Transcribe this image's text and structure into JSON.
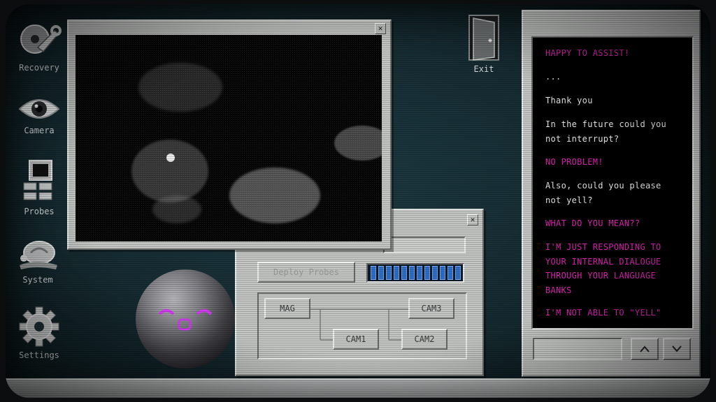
{
  "desktop": {
    "icons": [
      {
        "label": "Recovery",
        "icon": "wrench-disc-icon"
      },
      {
        "label": "Camera",
        "icon": "eye-icon"
      },
      {
        "label": "Probes",
        "icon": "probes-icon"
      },
      {
        "label": "System",
        "icon": "snail-system-icon"
      },
      {
        "label": "Settings",
        "icon": "gear-icon"
      }
    ],
    "exit": {
      "label": "Exit",
      "icon": "door-icon"
    }
  },
  "probes_window": {
    "title_suffix": "!",
    "deploy_button": "Deploy Probes",
    "progress_segments": 12,
    "nodes": {
      "mag": "MAG",
      "cam1": "CAM1",
      "cam2": "CAM2",
      "cam3": "CAM3"
    }
  },
  "chat": {
    "messages": [
      {
        "speaker": "assistant",
        "text": "HAPPY TO ASSIST!"
      },
      {
        "speaker": "user",
        "text": "..."
      },
      {
        "speaker": "user",
        "text": "Thank you"
      },
      {
        "speaker": "user",
        "text": "In the future could you not interrupt?"
      },
      {
        "speaker": "assistant",
        "text": "NO PROBLEM!"
      },
      {
        "speaker": "user",
        "text": "Also, could you please not yell?"
      },
      {
        "speaker": "assistant",
        "text": "WHAT DO YOU MEAN??"
      },
      {
        "speaker": "assistant",
        "text": "I'M JUST RESPONDING TO YOUR INTERNAL DIALOGUE THROUGH YOUR LANGUAGE BANKS"
      },
      {
        "speaker": "assistant",
        "text": "I'M NOT ABLE TO \"YELL\""
      }
    ],
    "input_value": "",
    "scroll_up_icon": "chevron-up-icon",
    "scroll_down_icon": "chevron-down-icon"
  },
  "colors": {
    "assistant_text": "#e021b4",
    "user_text": "#e9e9e9",
    "bot_face": "#d23cf0",
    "progress": "#2f6fc7"
  }
}
